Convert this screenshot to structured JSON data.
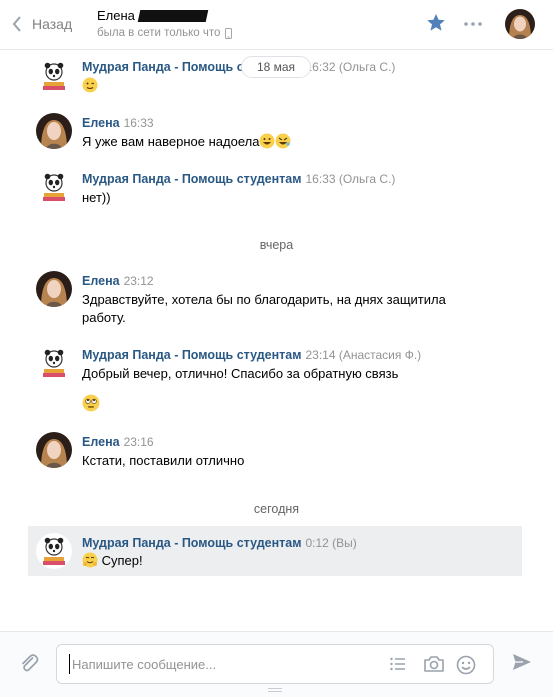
{
  "header": {
    "back_label": "Назад",
    "peer_name": "Елена",
    "peer_status": "была в сети только что"
  },
  "chat": {
    "sticky_date": "18 мая",
    "messages": [
      {
        "author": "Мудрая Панда - Помощь студентам",
        "time": "16:32 (Ольга С.)",
        "text": "",
        "emoji": "wink"
      },
      {
        "author": "Елена",
        "time": "16:33",
        "text": "Я уже вам наверное надоела",
        "emoji": "grin-rofl"
      },
      {
        "author": "Мудрая Панда - Помощь студентам",
        "time": "16:33 (Ольга С.)",
        "text": "нет))"
      },
      {
        "author": "Елена",
        "time": "23:12",
        "text": "Здравствуйте, хотела бы по благодарить, на днях защитила работу."
      },
      {
        "author": "Мудрая Панда - Помощь студентам",
        "time": "23:14 (Анастасия Ф.)",
        "text": "Добрый вечер, отлично! Спасибо за обратную связь",
        "emoji": "rolling-eyes"
      },
      {
        "author": "Елена",
        "time": "23:16",
        "text": "Кстати, поставили отлично"
      },
      {
        "author": "Мудрая Панда - Помощь студентам",
        "time": "0:12 (Вы)",
        "text": "Супер!",
        "emoji": "hugging"
      }
    ],
    "dividers": [
      "вчера",
      "сегодня"
    ]
  },
  "composer": {
    "placeholder": "Напишите сообщение..."
  },
  "colors": {
    "link": "#2a5885",
    "accent": "#5181b8",
    "highlight_bg": "#edeef0"
  }
}
